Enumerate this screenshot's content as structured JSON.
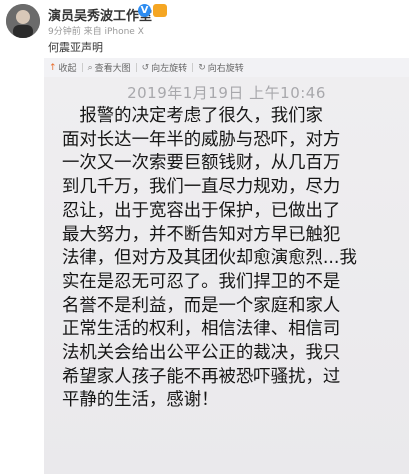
{
  "post": {
    "username": "演员吴秀波工作室",
    "meta": "9分钟前 来自 iPhone X",
    "text": "何震亚声明"
  },
  "toolbar": {
    "collapse": "收起",
    "view_large": "查看大图",
    "rotate_left": "向左旋转",
    "rotate_right": "向右旋转"
  },
  "colors": {
    "verified": "#2d8cf0",
    "accent": "#e86c2b"
  },
  "note": {
    "date": "2019年1月19日 上午10:46",
    "lines": [
      "　报警的决定考虑了很久，我们家",
      "面对长达一年半的威胁与恐吓，对方",
      "一次又一次索要巨额钱财，从几百万",
      "到几千万，我们一直尽力规劝，尽力",
      "忍让，出于宽容出于保护，已做出了",
      "最大努力，并不断告知对方早已触犯",
      "法律，但对方及其团伙却愈演愈烈...我",
      "实在是忍无可忍了。我们捍卫的不是",
      "名誉不是利益，而是一个家庭和家人",
      "正常生活的权利，相信法律、相信司",
      "法机关会给出公平公正的裁决，我只",
      "希望家人孩子能不再被恐吓骚扰，过",
      "平静的生活，感谢！"
    ]
  }
}
